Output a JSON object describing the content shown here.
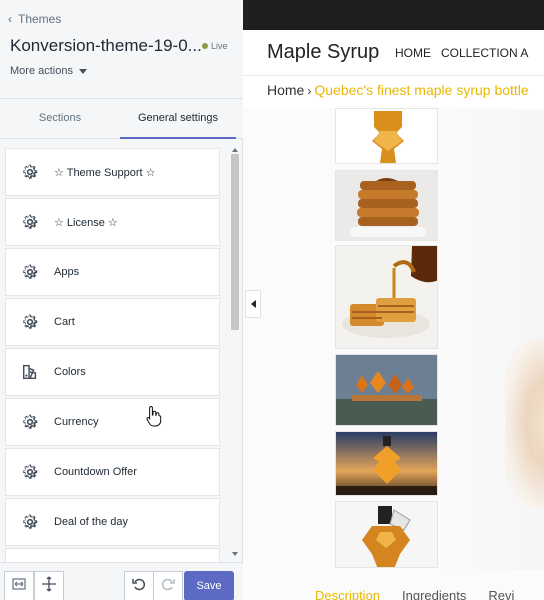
{
  "editor": {
    "back_label": "Themes",
    "theme_name": "Konversion-theme-19-0...",
    "live_label": "Live",
    "more_actions_label": "More actions",
    "tabs": [
      {
        "label": "Sections",
        "active": false
      },
      {
        "label": "General settings",
        "active": true
      }
    ],
    "settings": [
      {
        "label": "☆ Theme Support ☆",
        "icon": "gear-icon"
      },
      {
        "label": "☆ License ☆",
        "icon": "gear-icon"
      },
      {
        "label": "Apps",
        "icon": "gear-icon"
      },
      {
        "label": "Cart",
        "icon": "gear-icon"
      },
      {
        "label": "Colors",
        "icon": "paint-bucket-icon"
      },
      {
        "label": "Currency",
        "icon": "gear-icon"
      },
      {
        "label": "Countdown Offer",
        "icon": "gear-icon"
      },
      {
        "label": "Deal of the day",
        "icon": "gear-icon"
      }
    ],
    "footer": {
      "save_label": "Save"
    },
    "accent_color": "#5c6ac4"
  },
  "preview": {
    "store_name": "Maple Syrup",
    "nav_links": [
      "HOME",
      "COLLECTION A"
    ],
    "breadcrumb": {
      "home": "Home",
      "separator": "›",
      "current": "Quebec's finest maple syrup bottle"
    },
    "thumbnails": [
      {
        "name": "thumbnail-maple-bottle-top"
      },
      {
        "name": "thumbnail-pancake-stack"
      },
      {
        "name": "thumbnail-waffles-syrup-pour"
      },
      {
        "name": "thumbnail-maple-leaf-bottles-row"
      },
      {
        "name": "thumbnail-maple-leaf-bottle-sunset"
      },
      {
        "name": "thumbnail-maple-bottle-tag"
      }
    ],
    "product_tabs": [
      {
        "label": "Description",
        "active": true
      },
      {
        "label": "Ingredients",
        "active": false
      },
      {
        "label": "Revi",
        "active": false
      }
    ],
    "highlight_color": "#e8b800"
  }
}
